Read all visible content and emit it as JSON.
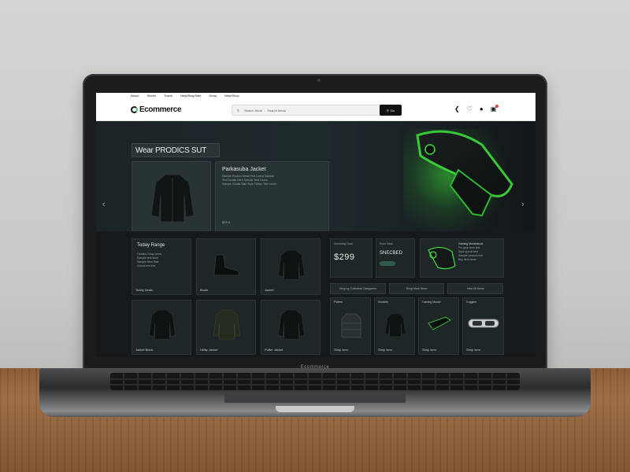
{
  "top_links": [
    "About",
    "Stores",
    "Travel",
    "Help/Blog/Sale",
    "Hoop",
    "Help/Shop"
  ],
  "logo": {
    "text": "Ecommerce"
  },
  "search": {
    "placeholder": "Search Store",
    "label": "Search Items",
    "button_label": "Go"
  },
  "header_icons": [
    "share-icon",
    "heart-icon",
    "user-icon",
    "cart-icon"
  ],
  "hero": {
    "title": "Wear PRODICS SUT",
    "card_title": "Parkasuba Jacket",
    "card_text": [
      "Sample Product Detail Text Lorem Sample",
      "Text Details Here Sample Text Lorem",
      "Sample Goods Sale Style Fiction Text Lorem"
    ],
    "card_price": "$29.9"
  },
  "featured": {
    "title": "Today Range",
    "lines": [
      "Fashion Shop Lines",
      "Sample text store",
      "Sample Item Sale",
      "Goods text line"
    ],
    "label": "Today Deals"
  },
  "products_row1": [
    {
      "label": "Boots"
    },
    {
      "label": "Jacket"
    }
  ],
  "deals": {
    "heading_left": "Sevenday Deal",
    "price": "$299",
    "heading_right": "Soon Deal",
    "sub_right": "SNECBED",
    "promo_title": "Gaming Mousebook",
    "promo_lines": [
      "Pro gear item line",
      "Style goods text",
      "Sample product text",
      "Buy item lorem"
    ]
  },
  "bar_links": [
    "Shop by Collection Categories",
    "Shop More Store",
    "View All Items"
  ],
  "products_row2": [
    {
      "label": "Jacket Black"
    },
    {
      "label": "Utility Jacket"
    },
    {
      "label": "Puffer Jacket"
    }
  ],
  "products_row3": [
    {
      "label": "Puffers",
      "foot": "Shop item"
    },
    {
      "label": "Hoodies",
      "foot": "Shop item"
    },
    {
      "label": "Gaming Mouse",
      "foot": "Shop item"
    },
    {
      "label": "Goggles",
      "foot": "Shop item"
    }
  ],
  "laptop_brand": "Ecommerce",
  "colors": {
    "accent": "#3cdc3c",
    "dark_bg": "#15191b",
    "panel": "#1e2628"
  }
}
